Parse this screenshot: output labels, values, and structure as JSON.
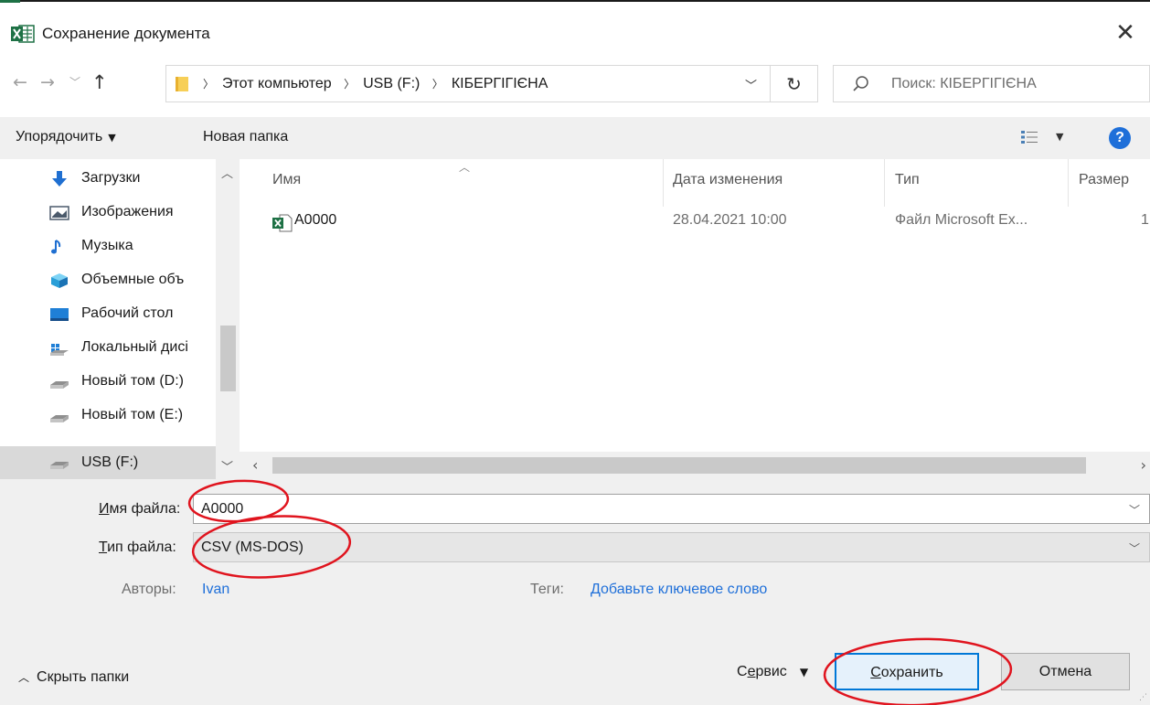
{
  "window": {
    "title": "Сохранение документа",
    "close_glyph": "✕"
  },
  "address": {
    "crumbs": [
      "Этот компьютер",
      "USB (F:)",
      "КІБЕРГІГІЄНА"
    ],
    "search_placeholder": "Поиск: КІБЕРГІГІЄНА"
  },
  "toolbar": {
    "organize_label": "Упорядочить",
    "new_folder_label": "Новая папка",
    "help_label": "?"
  },
  "nav": {
    "items": [
      {
        "label": "Загрузки",
        "icon": "downloads-icon"
      },
      {
        "label": "Изображения",
        "icon": "pictures-icon"
      },
      {
        "label": "Музыка",
        "icon": "music-icon"
      },
      {
        "label": "Объемные объ",
        "icon": "3d-objects-icon"
      },
      {
        "label": "Рабочий стол",
        "icon": "desktop-icon"
      },
      {
        "label": "Локальный дисі",
        "icon": "local-disk-icon"
      },
      {
        "label": "Новый том (D:)",
        "icon": "drive-icon"
      },
      {
        "label": "Новый том (E:)",
        "icon": "drive-icon"
      },
      {
        "label": "USB (F:)",
        "icon": "usb-drive-icon"
      }
    ]
  },
  "files": {
    "columns": {
      "name": "Имя",
      "modified": "Дата изменения",
      "type": "Тип",
      "size": "Размер"
    },
    "rows": [
      {
        "name": "A0000",
        "modified": "28.04.2021 10:00",
        "type": "Файл Microsoft Ex...",
        "size": "1"
      }
    ]
  },
  "form": {
    "filename_label_underlined": "И",
    "filename_label_rest": "мя файла:",
    "filename_value": "A0000",
    "filetype_label_underlined": "Т",
    "filetype_label_rest": "ип файла:",
    "filetype_value": "CSV (MS-DOS)",
    "authors_label": "Авторы:",
    "authors_value": "Ivan",
    "tags_label": "Теги:",
    "tags_value": "Добавьте ключевое слово"
  },
  "footer": {
    "hide_folders_label": "Скрыть папки",
    "service_pre": "С",
    "service_underlined": "е",
    "service_post": "рвис",
    "save_underlined": "С",
    "save_rest": "охранить",
    "cancel_label": "Отмена"
  },
  "colors": {
    "accent": "#0078d7",
    "link": "#1e6fd9",
    "annotation": "#e0141e",
    "excel_green": "#1e7145"
  }
}
